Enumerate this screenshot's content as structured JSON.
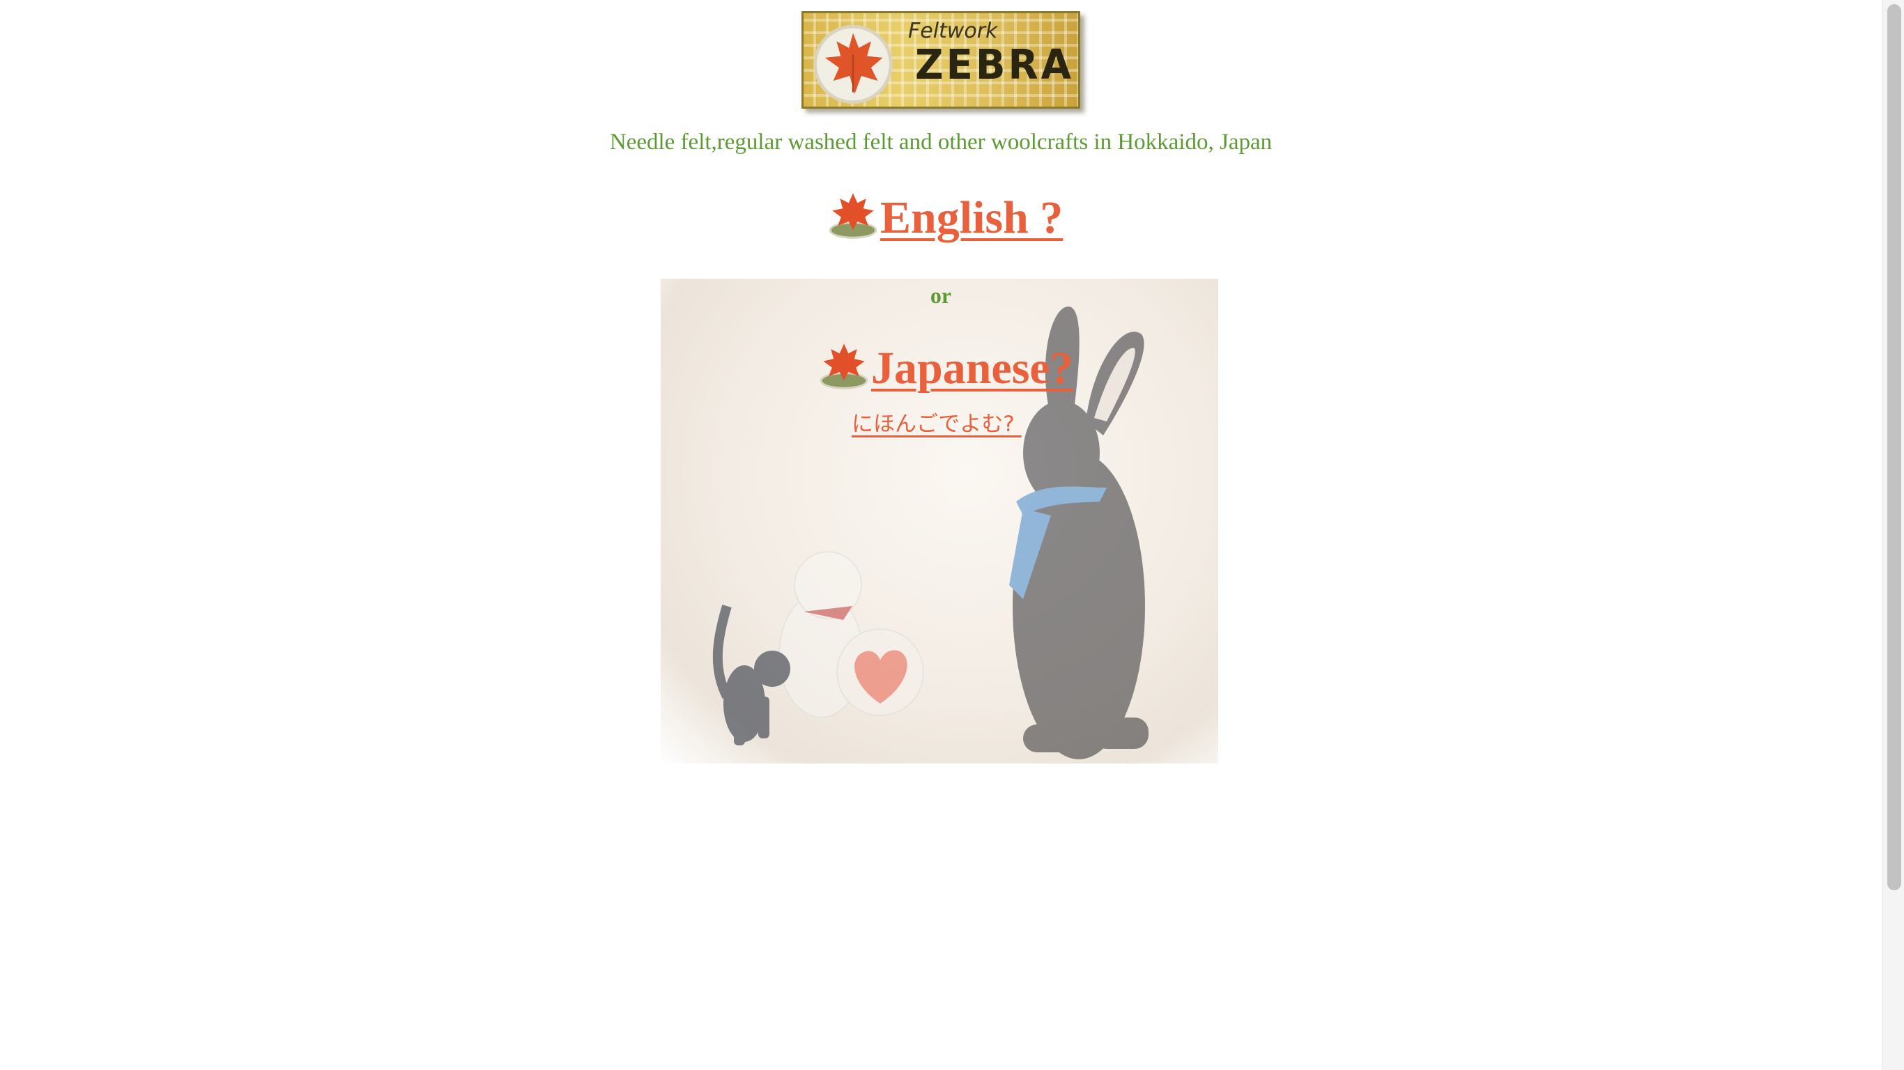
{
  "logo": {
    "small_text": "Feltwork",
    "big_text": "ZEBRA",
    "icon": "felt-maple-leaf-icon"
  },
  "tagline": "Needle felt,regular washed felt and other woolcrafts in Hokkaido, Japan",
  "links": {
    "english": "English ?",
    "or": "or",
    "japanese": "Japanese?",
    "japanese_sub": "にほんごでよむ? "
  },
  "icons": {
    "link_bullet": "felt-maple-leaf-icon"
  },
  "colors": {
    "link": "#e8613c",
    "tagline": "#5d9a34",
    "background": "#ffffff"
  }
}
